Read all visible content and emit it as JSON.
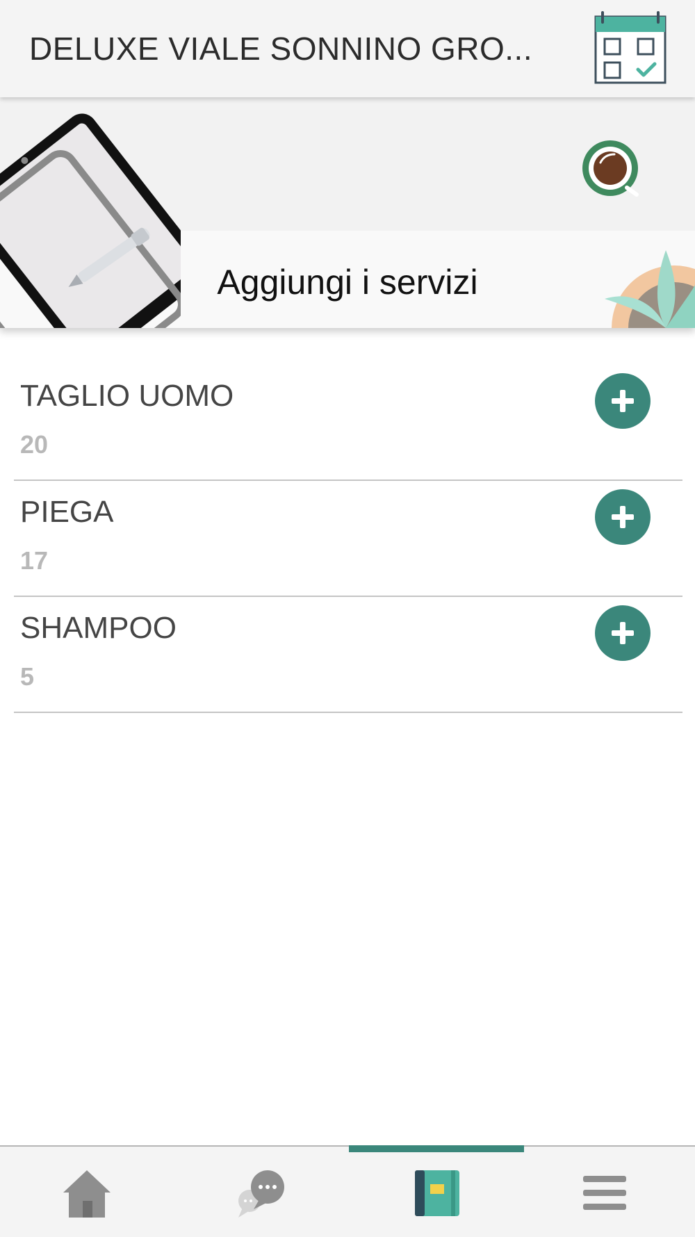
{
  "header": {
    "title": "DELUXE VIALE SONNINO GRO...",
    "calendar_icon": "calendar-check-icon"
  },
  "banner": {
    "title": "Aggiungi i servizi",
    "decorations": [
      "tablet-illustration",
      "coffee-cup-illustration",
      "plant-illustration"
    ]
  },
  "services": [
    {
      "name": "TAGLIO UOMO",
      "price": "20"
    },
    {
      "name": "PIEGA",
      "price": "17"
    },
    {
      "name": "SHAMPOO",
      "price": "5"
    }
  ],
  "bottom_nav": {
    "items": [
      {
        "icon": "home-icon"
      },
      {
        "icon": "chat-icon"
      },
      {
        "icon": "book-icon",
        "active": true
      },
      {
        "icon": "menu-icon"
      }
    ]
  },
  "colors": {
    "accent": "#3b877b",
    "header_bg": "#f4f4f4",
    "price_text": "#b8b8b8",
    "divider": "#c4c4c4"
  }
}
